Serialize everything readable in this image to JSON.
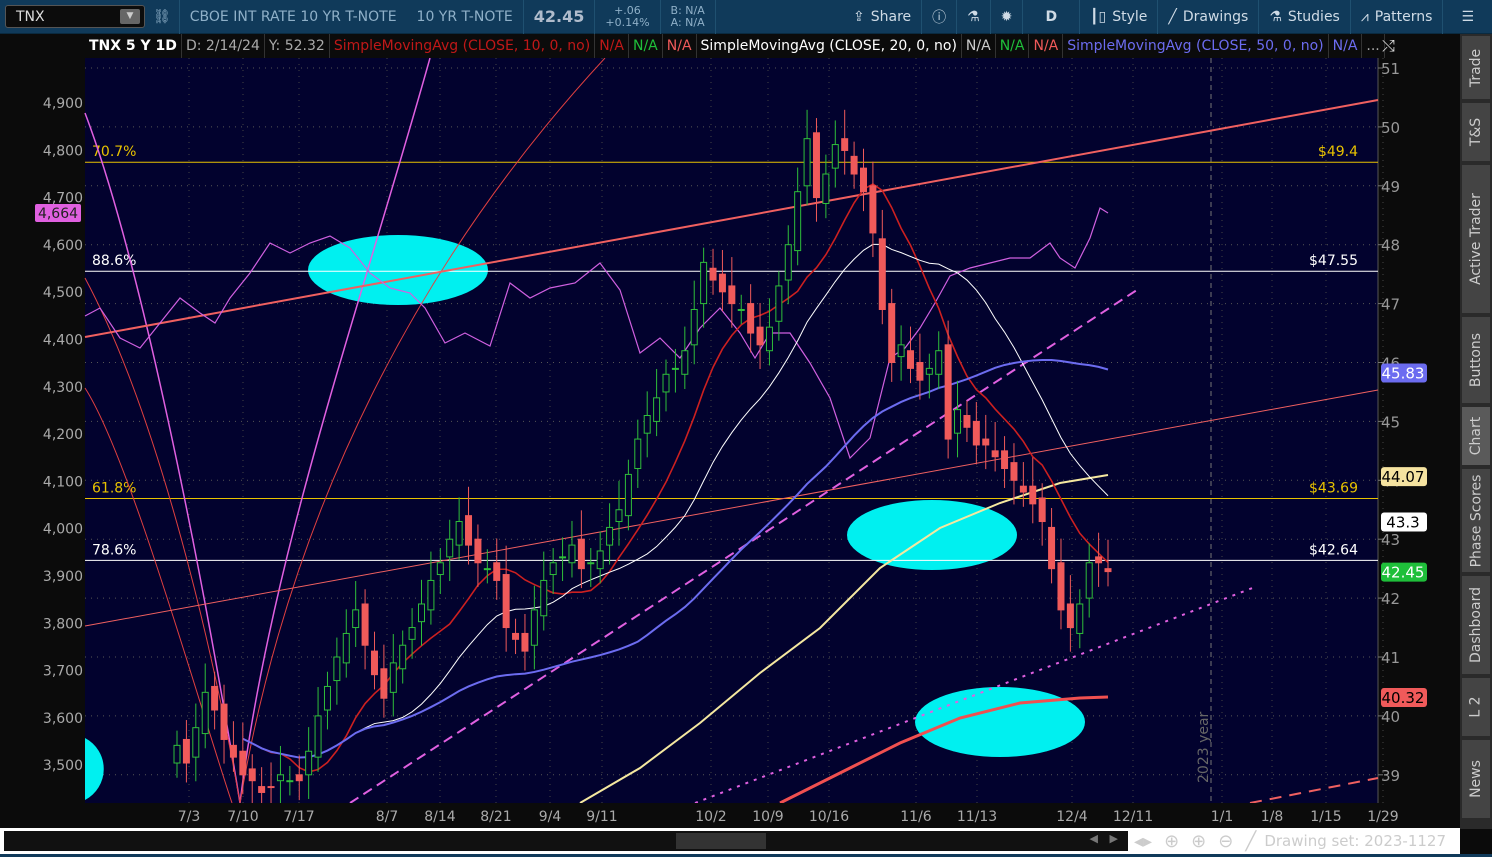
{
  "toolbar": {
    "symbol": "TNX",
    "description": "CBOE INT RATE 10 YR T-NOTE",
    "short_name": "10 YR T-NOTE",
    "last": "42.45",
    "change": "+.06",
    "change_pct": "+0.14%",
    "bid": "B: N/A",
    "ask": "A: N/A",
    "share": "Share",
    "aggregation": "D",
    "style": "Style",
    "drawings": "Drawings",
    "studies": "Studies",
    "patterns": "Patterns"
  },
  "header": {
    "title": "TNX 5 Y 1D",
    "date": "D: 2/14/24",
    "y": "Y: 52.32",
    "sma10": "SimpleMovingAvg (CLOSE, 10, 0, no)",
    "sma20": "SimpleMovingAvg (CLOSE, 20, 0, no)",
    "sma50": "SimpleMovingAvg (CLOSE, 50, 0, no)",
    "na": "N/A",
    "more": "..."
  },
  "right_tabs": [
    "Trade",
    "T&S",
    "Active Trader",
    "Buttons",
    "Chart",
    "Phase Scores",
    "Dashboard",
    "L 2",
    "News"
  ],
  "bottom": {
    "drawing_set": "Drawing set: 2023-1127"
  },
  "chart_data": {
    "type": "candlestick",
    "right_axis": {
      "ticks": [
        "51",
        "50",
        "49",
        "48",
        "47",
        "46",
        "45",
        "44",
        "43",
        "42",
        "41",
        "40",
        "39"
      ],
      "range": [
        38.5,
        51.2
      ]
    },
    "left_axis": {
      "ticks": [
        "4,900",
        "4,800",
        "4,700",
        "4,600",
        "4,500",
        "4,400",
        "4,300",
        "4,200",
        "4,100",
        "4,000",
        "3,900",
        "3,800",
        "3,700",
        "3,600",
        "3,500"
      ],
      "marker": "4,664"
    },
    "x_ticks": [
      "7/3",
      "7/10",
      "7/17",
      "8/7",
      "8/14",
      "8/21",
      "9/4",
      "9/11",
      "10/2",
      "10/9",
      "10/16",
      "11/6",
      "11/13",
      "12/4",
      "12/11",
      "1/1",
      "1/8",
      "1/15",
      "1/29"
    ],
    "fib_levels": [
      {
        "pct": "70.7%",
        "price": "$49.4",
        "value": 49.4,
        "color": "#e8c200"
      },
      {
        "pct": "88.6%",
        "price": "$47.55",
        "value": 47.55,
        "color": "#ffffff"
      },
      {
        "pct": "61.8%",
        "price": "$43.69",
        "value": 43.69,
        "color": "#e8c200"
      },
      {
        "pct": "78.6%",
        "price": "$42.64",
        "value": 42.64,
        "color": "#ffffff"
      }
    ],
    "badges": [
      {
        "label": "45.83",
        "bg": "#6c6cf0",
        "fg": "#ffffff",
        "value": 45.83
      },
      {
        "label": "44.07",
        "bg": "#f5e3a0",
        "fg": "#000000",
        "value": 44.07
      },
      {
        "label": "43.3",
        "bg": "#ffffff",
        "fg": "#000000",
        "value": 43.3
      },
      {
        "label": "42.45",
        "bg": "#1fbf3a",
        "fg": "#ffffff",
        "value": 42.45
      },
      {
        "label": "40.32",
        "bg": "#f05a5a",
        "fg": "#000000",
        "value": 40.32
      }
    ],
    "annotation": "2023 year",
    "closes": [
      39.5,
      39.2,
      39.8,
      40.4,
      40.1,
      39.6,
      39.3,
      39.0,
      38.9,
      38.7,
      38.8,
      39.0,
      38.9,
      38.9,
      39.4,
      40.0,
      40.5,
      41.0,
      41.4,
      41.8,
      41.2,
      40.7,
      40.3,
      40.9,
      41.2,
      41.5,
      41.9,
      42.3,
      42.6,
      43.0,
      43.3,
      42.9,
      42.6,
      42.5,
      42.3,
      41.5,
      41.3,
      41.1,
      41.8,
      42.3,
      42.6,
      42.7,
      42.9,
      42.5,
      42.6,
      42.8,
      43.2,
      43.5,
      44.1,
      44.7,
      45.1,
      45.4,
      45.8,
      45.9,
      46.2,
      46.9,
      47.7,
      47.4,
      47.2,
      47.0,
      46.9,
      46.5,
      46.3,
      46.6,
      47.3,
      48.0,
      48.9,
      49.8,
      48.8,
      49.2,
      49.7,
      49.6,
      49.2,
      48.9,
      48.2,
      46.9,
      46.0,
      46.3,
      45.9,
      45.7,
      45.9,
      46.2,
      44.7,
      45.2,
      44.9,
      44.6,
      44.6,
      44.4,
      44.2,
      44.0,
      43.8,
      43.6,
      43.3,
      42.5,
      41.8,
      41.5,
      41.9,
      42.6,
      42.6,
      42.45
    ],
    "colors": {
      "up": "#2fbf3a",
      "down": "#f05a5a",
      "sma10": "#cc2020",
      "sma20": "#ffffff",
      "sma50": "#6c6cf0",
      "background": "#02022e"
    }
  }
}
